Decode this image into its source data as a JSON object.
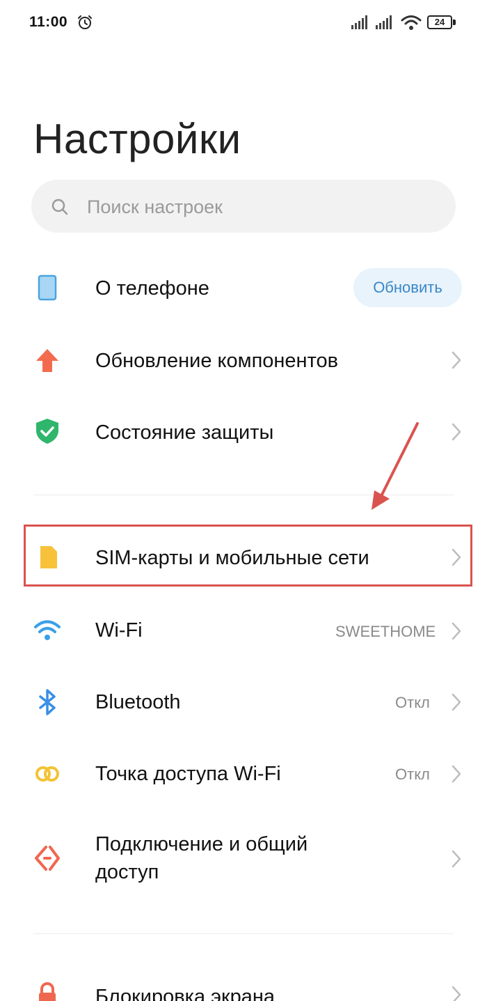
{
  "status_bar": {
    "time": "11:00",
    "battery": "24"
  },
  "page": {
    "title": "Настройки"
  },
  "search": {
    "placeholder": "Поиск настроек"
  },
  "items": [
    {
      "label": "О телефоне",
      "button": "Обновить",
      "icon": "phone-icon",
      "color": "#4aa3df"
    },
    {
      "label": "Обновление компонентов",
      "icon": "update-arrow-icon",
      "color": "#f26b4f"
    },
    {
      "label": "Состояние защиты",
      "icon": "shield-icon",
      "color": "#2fb66c"
    },
    {
      "label": "SIM-карты и мобильные сети",
      "icon": "sim-card-icon",
      "color": "#f7c23a"
    },
    {
      "label": "Wi-Fi",
      "value": "SWEETHOME",
      "icon": "wifi-icon",
      "color": "#3aa0e6"
    },
    {
      "label": "Bluetooth",
      "value": "Откл",
      "icon": "bluetooth-icon",
      "color": "#3a8fe6"
    },
    {
      "label": "Точка доступа Wi-Fi",
      "value": "Откл",
      "icon": "hotspot-icon",
      "color": "#f4c233"
    },
    {
      "label_line1": "Подключение и общий",
      "label_line2": "доступ",
      "icon": "share-icon",
      "color": "#f0674f"
    },
    {
      "label": "Блокировка экрана",
      "icon": "lock-icon",
      "color": "#f0674f"
    }
  ],
  "annotation": {
    "highlight_color": "#d9534f"
  }
}
